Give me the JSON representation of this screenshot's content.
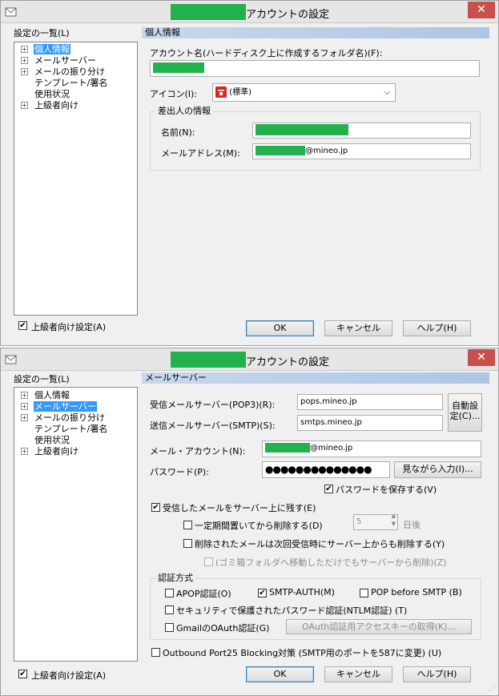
{
  "window": {
    "title": "アカウントの設定",
    "close": "✕"
  },
  "sidebar": {
    "heading": "設定の一覧(L)",
    "items": [
      "個人情報",
      "メールサーバー",
      "メールの振り分け",
      "テンプレート/署名",
      "使用状況",
      "上級者向け"
    ],
    "advanced_checkbox": "上級者向け設定(A)"
  },
  "buttons": {
    "ok": "OK",
    "cancel": "キャンセル",
    "help": "ヘルプ(H)"
  },
  "personal": {
    "section_title": "個人情報",
    "account_name_label": "アカウント名(ハードディスク上に作成するフォルダ名)(F):",
    "icon_label": "アイコン(I):",
    "icon_value": "(標準)",
    "sender_group": "差出人の情報",
    "name_label": "名前(N):",
    "email_label": "メールアドレス(M):",
    "email_suffix": "@mineo.jp"
  },
  "server": {
    "section_title": "メールサーバー",
    "pop_label": "受信メールサーバー(POP3)(R):",
    "pop_value": "pops.mineo.jp",
    "smtp_label": "送信メールサーバー(SMTP)(S):",
    "smtp_value": "smtps.mineo.jp",
    "auto_button": "自動設定(C)...",
    "account_label": "メール・アカウント(N):",
    "account_suffix": "@mineo.jp",
    "password_label": "パスワード(P):",
    "password_value": "●●●●●●●●●●●●●●",
    "show_password_button": "見ながら入力(I)...",
    "save_password": "パスワードを保存する(V)",
    "leave_on_server": "受信したメールをサーバー上に残す(E)",
    "delete_after": "一定期間置いてから削除する(D)",
    "days_value": "5",
    "days_unit": "日後",
    "delete_when_removed": "削除されたメールは次回受信時にサーバー上からも削除する(Y)",
    "trash_note": "(ゴミ箱フォルダへ移動しただけでもサーバーから削除)(Z)",
    "auth_group": "認証方式",
    "apop": "APOP認証(O)",
    "smtp_auth": "SMTP-AUTH(M)",
    "pop_before_smtp": "POP before SMTP (B)",
    "ntlm": "セキュリティで保護されたパスワード認証(NTLM認証) (T)",
    "gmail_oauth": "GmailのOAuth認証(G)",
    "oauth_button": "OAuth認証用アクセスキーの取得(K)...",
    "outbound25": "Outbound Port25 Blocking対策 (SMTP用のポートを587に変更) (U)"
  },
  "colors": {
    "redaction": "#22b14c",
    "selection": "#3399ff",
    "close": "#c7504c"
  }
}
